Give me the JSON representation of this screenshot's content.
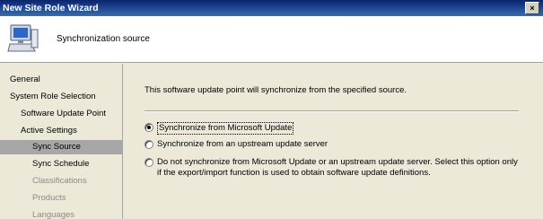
{
  "window": {
    "title": "New Site Role Wizard",
    "close_glyph": "×"
  },
  "header": {
    "title": "Synchronization source",
    "icon": "computer-icon"
  },
  "sidebar": {
    "items": [
      {
        "label": "General",
        "state": "normal"
      },
      {
        "label": "System Role Selection",
        "state": "normal"
      },
      {
        "label": "Software Update Point",
        "state": "normal"
      },
      {
        "label": "Active Settings",
        "state": "normal"
      },
      {
        "label": "Sync Source",
        "state": "selected"
      },
      {
        "label": "Sync Schedule",
        "state": "normal"
      },
      {
        "label": "Classifications",
        "state": "disabled"
      },
      {
        "label": "Products",
        "state": "disabled"
      },
      {
        "label": "Languages",
        "state": "disabled"
      }
    ]
  },
  "main": {
    "intro": "This software update point will synchronize from the specified source.",
    "options": [
      {
        "label": "Synchronize from Microsoft Update",
        "checked": true
      },
      {
        "label": "Synchronize from an upstream update server",
        "checked": false
      },
      {
        "label_line1": "Do not synchronize from Microsoft Update or an upstream update server. Select this option only",
        "label_line2": "if the export/import function is used to obtain software update definitions.",
        "checked": false
      }
    ]
  }
}
